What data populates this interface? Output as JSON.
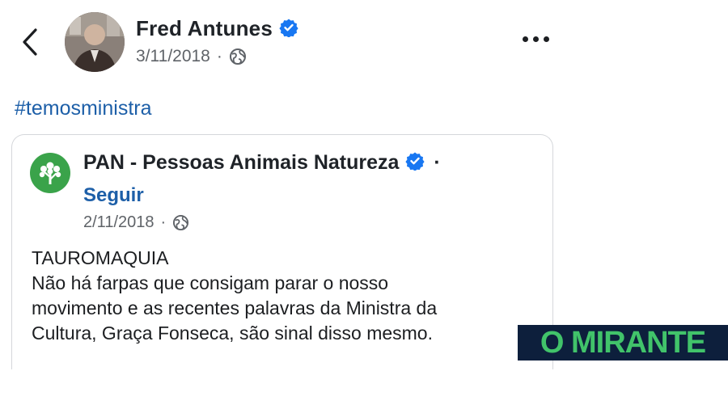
{
  "post": {
    "author": "Fred Antunes",
    "date": "3/11/2018",
    "separator": "·",
    "hashtag": "#temosministra",
    "icons": {
      "back": "chevron-left-icon",
      "verified": "verified-badge-icon",
      "audience": "globe-icon",
      "more": "more-options-icon"
    }
  },
  "shared": {
    "page_name": "PAN - Pessoas Animais Natureza",
    "name_separator": "·",
    "follow": "Seguir",
    "date": "2/11/2018",
    "separator": "·",
    "text": "TAUROMAQUIA\nNão há farpas que consigam parar o nosso\nmovimento e as recentes palavras da Ministra da\nCultura, Graça Fonseca, são sinal disso mesmo."
  },
  "watermark": {
    "text": "O MIRANTE"
  },
  "colors": {
    "link": "#1d5fa8",
    "verified": "#1877f2",
    "pan_green": "#3aa34a",
    "watermark_bg": "#0d1f3c",
    "watermark_text": "#41c36a"
  }
}
